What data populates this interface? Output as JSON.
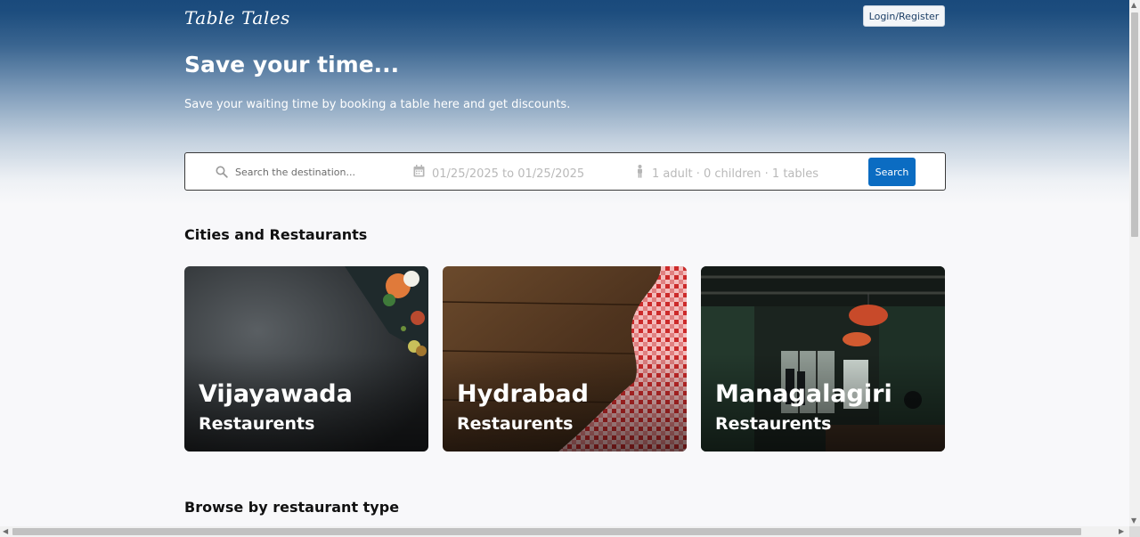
{
  "header": {
    "logo": "Table Tales",
    "login_label": "Login/Register"
  },
  "hero": {
    "title": "Save your time...",
    "subtitle": "Save your waiting time by booking a table here and get discounts."
  },
  "search": {
    "destination_placeholder": "Search the destination...",
    "date_range": "01/25/2025 to 01/25/2025",
    "guests": "1 adult · 0 children · 1 tables",
    "button_label": "Search"
  },
  "sections": {
    "cities_title": "Cities and Restaurants",
    "browse_title": "Browse by restaurant type"
  },
  "cities": [
    {
      "name": "Vijayawada",
      "label": "Restaurents"
    },
    {
      "name": "Hydrabad",
      "label": "Restaurents"
    },
    {
      "name": "Managalagiri",
      "label": "Restaurents"
    }
  ],
  "colors": {
    "header_blue": "#1a4a7c",
    "search_button": "#0b6cc2"
  },
  "icons": [
    "search-icon",
    "calendar-icon",
    "person-icon"
  ]
}
